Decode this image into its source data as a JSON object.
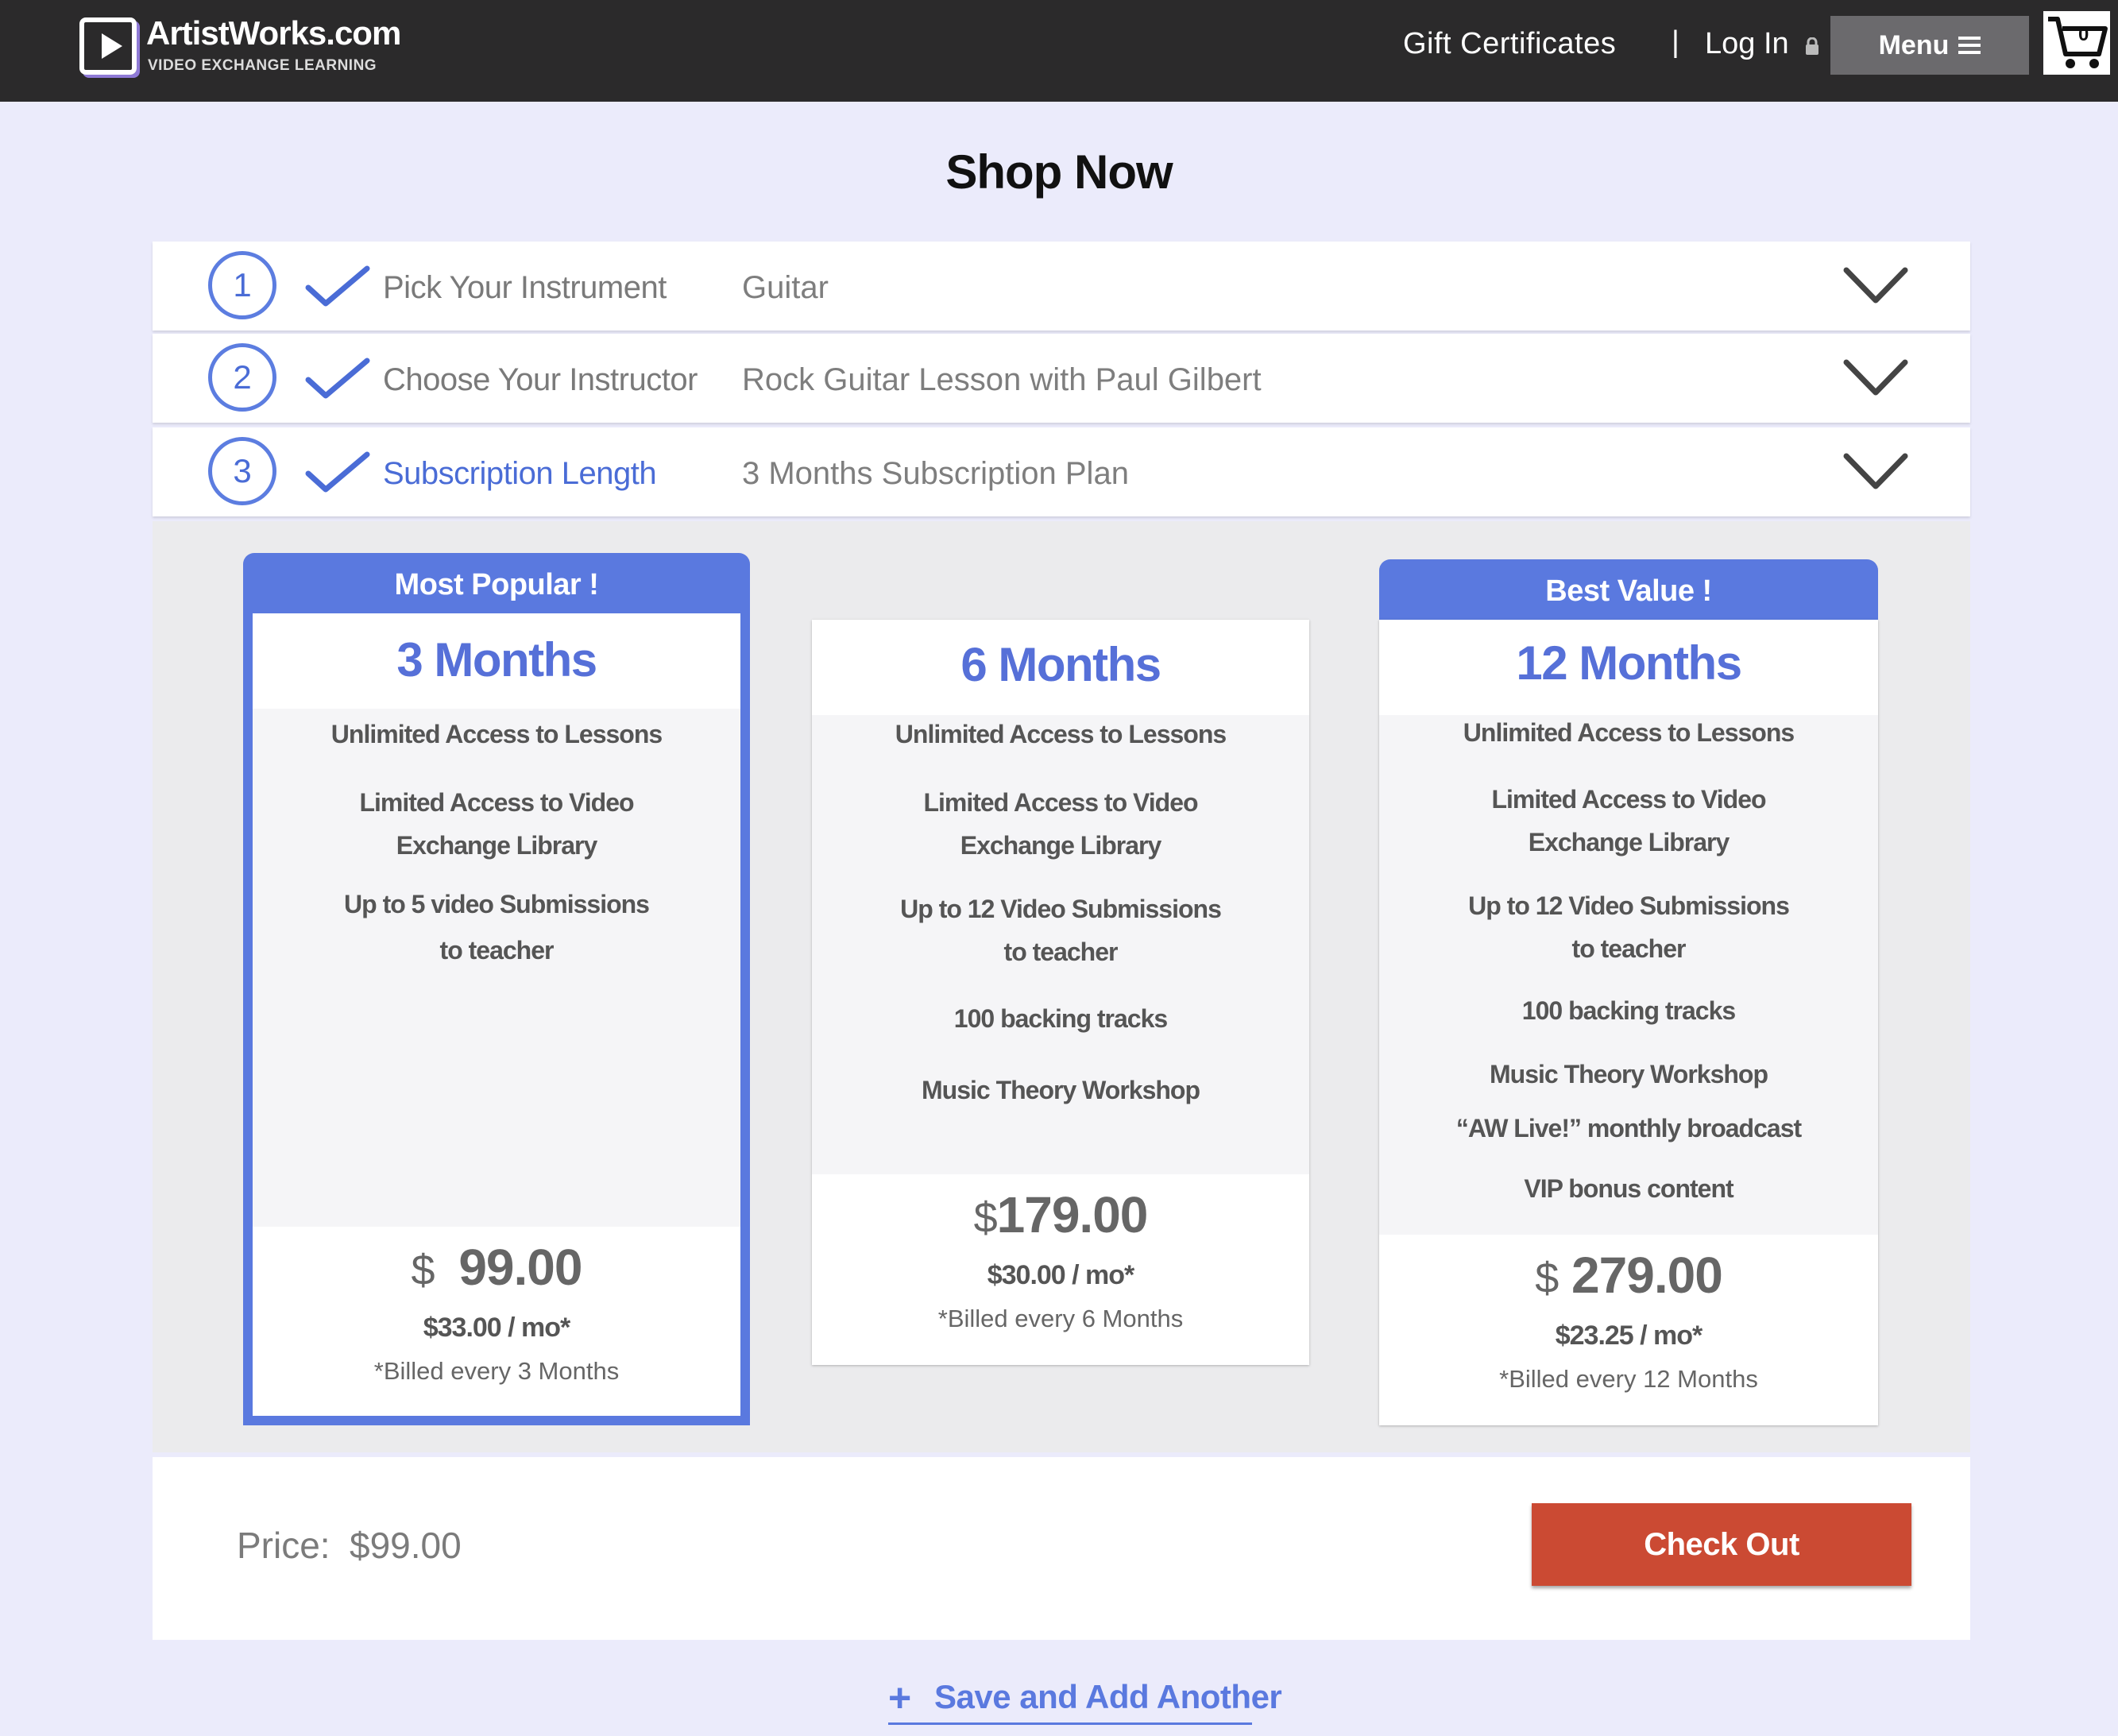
{
  "header": {
    "logo_name": "ArtistWorks.com",
    "logo_tagline": "VIDEO EXCHANGE LEARNING",
    "gift_label": "Gift Certificates",
    "separator": "|",
    "login_label": "Log In",
    "menu_label": "Menu",
    "cart_count": "0"
  },
  "page_title": "Shop Now",
  "steps": [
    {
      "number": "1",
      "label": "Pick Your Instrument",
      "value": "Guitar",
      "active": false
    },
    {
      "number": "2",
      "label": "Choose Your Instructor",
      "value": "Rock Guitar Lesson with Paul Gilbert",
      "active": false
    },
    {
      "number": "3",
      "label": "Subscription Length",
      "value": "3 Months Subscription Plan",
      "active": true
    }
  ],
  "plans": [
    {
      "badge": "Most Popular !",
      "title": "3 Months",
      "features": [
        "Unlimited Access to Lessons",
        "Limited Access to Video",
        "Exchange Library",
        "Up to 5 video Submissions",
        "to teacher"
      ],
      "currency": "$",
      "price": "99.00",
      "per_month": "$33.00 / mo*",
      "billed": "*Billed every 3 Months",
      "selected": true
    },
    {
      "badge": "",
      "title": "6 Months",
      "features": [
        "Unlimited Access to Lessons",
        "Limited Access to Video",
        "Exchange Library",
        "Up to 12 Video Submissions",
        "to teacher",
        "100 backing tracks",
        "Music Theory Workshop"
      ],
      "currency": "$",
      "price": "179.00",
      "per_month": "$30.00 / mo*",
      "billed": "*Billed every 6 Months",
      "selected": false
    },
    {
      "badge": "Best Value !",
      "title": "12 Months",
      "features": [
        "Unlimited Access to Lessons",
        "Limited Access to Video",
        "Exchange Library",
        "Up to 12 Video Submissions",
        "to teacher",
        "100 backing tracks",
        "Music Theory Workshop",
        "“AW Live!” monthly broadcast",
        "VIP bonus content"
      ],
      "currency": "$",
      "price": "279.00",
      "per_month": "$23.25 / mo*",
      "billed": "*Billed every 12 Months",
      "selected": false
    }
  ],
  "checkout": {
    "price_label": "Price:",
    "price_value": "$99.00",
    "button_label": "Check Out"
  },
  "save_another": {
    "plus": "+",
    "label": "Save and Add Another"
  },
  "colors": {
    "accent": "#5a79df",
    "checkout": "#cb4a33",
    "topbar": "#2b2a2b",
    "background": "#ebebfb"
  }
}
